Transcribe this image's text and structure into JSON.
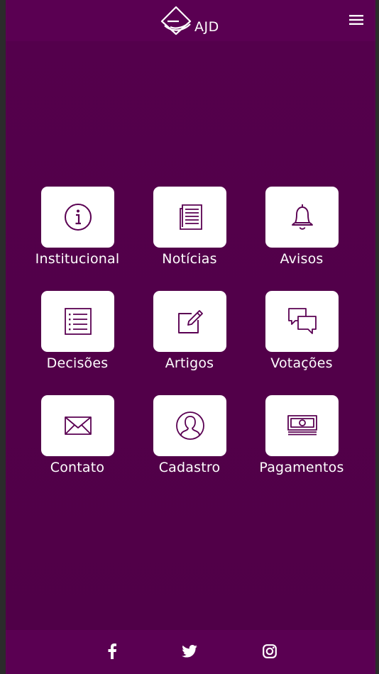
{
  "header": {
    "logo_text": "AJD",
    "logo_icon": "ajd-logo-icon",
    "menu_icon": "hamburger-menu-icon"
  },
  "tiles": [
    {
      "label": "Institucional",
      "icon": "info-icon"
    },
    {
      "label": "Notícias",
      "icon": "newspaper-icon"
    },
    {
      "label": "Avisos",
      "icon": "bell-icon"
    },
    {
      "label": "Decisões",
      "icon": "checklist-icon"
    },
    {
      "label": "Artigos",
      "icon": "edit-icon"
    },
    {
      "label": "Votações",
      "icon": "chat-bubbles-icon"
    },
    {
      "label": "Contato",
      "icon": "envelope-icon"
    },
    {
      "label": "Cadastro",
      "icon": "user-icon"
    },
    {
      "label": "Pagamentos",
      "icon": "money-icon"
    }
  ],
  "footer": {
    "social": [
      "facebook-icon",
      "twitter-icon",
      "instagram-icon"
    ]
  },
  "colors": {
    "background": "#520049",
    "bar": "#5a0052",
    "tile": "#ffffff",
    "icon_stroke": "#5a0052",
    "text": "#ffffff"
  }
}
